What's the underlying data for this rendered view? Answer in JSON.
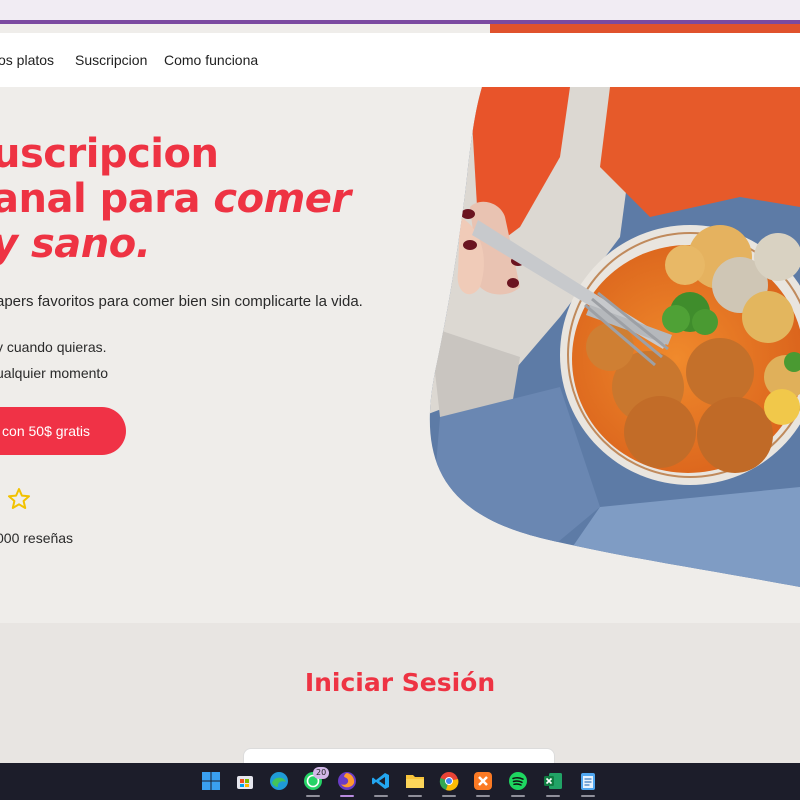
{
  "navbar": {
    "links": [
      "os platos",
      "Suscripcion",
      "Como funciona"
    ]
  },
  "hero": {
    "title_line1": "uscripcion",
    "title_line2_regular": "anal para ",
    "title_line2_italic": "comer",
    "title_line3": "y sano.",
    "subtitle": "apers favoritos para comer bien sin complicarte la vida.",
    "bullets": [
      "y cuando quieras.",
      "ualquier momento"
    ],
    "cta_label": "con 50$ gratis",
    "rating_icon": "star-outline-icon",
    "reviews_text": "000 reseñas"
  },
  "login": {
    "title": "Iniciar Sesión"
  },
  "taskbar": {
    "whatsapp_badge": "20",
    "apps": [
      "windows-start-icon",
      "microsoft-store-icon",
      "edge-icon",
      "whatsapp-icon",
      "firefox-icon",
      "vscode-icon",
      "file-explorer-icon",
      "chrome-icon",
      "xampp-icon",
      "spotify-icon",
      "excel-icon",
      "notepad-icon"
    ]
  },
  "colors": {
    "brand_red": "#ee3343",
    "cta_red": "#f03246",
    "hero_bg": "#efedea",
    "taskbar_bg": "#1c1d2a"
  }
}
